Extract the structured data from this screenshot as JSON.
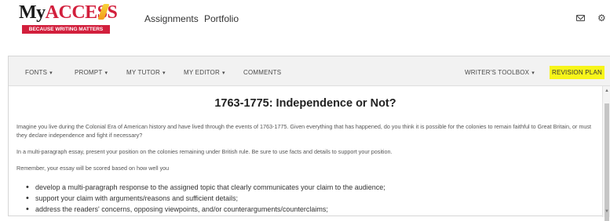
{
  "header": {
    "logo_text_prefix": "My",
    "logo_text_accent": "ACCESS",
    "logo_tagline": "BECAUSE WRITING MATTERS",
    "nav": [
      "Assignments",
      "Portfolio"
    ],
    "icons": [
      "mail-icon",
      "gear-icon"
    ]
  },
  "toolbar": {
    "fonts": "FONTS",
    "prompt": "PROMPT",
    "my_tutor": "MY TUTOR",
    "my_editor": "MY EDITOR",
    "comments": "COMMENTS",
    "writers_toolbox": "WRITER'S TOOLBOX",
    "revision_plan": "REVISION PLAN",
    "caret": "▾"
  },
  "prompt": {
    "title": "1763-1775: Independence or Not?",
    "paragraphs": [
      "Imagine you live during the Colonial Era of American history and have lived through the events of 1763-1775. Given everything that has happened, do you think it is possible for the colonies to remain faithful to Great Britain, or must they declare independence and fight if necessary?",
      "In a multi-paragraph essay, present your position on the colonies remaining under British rule. Be sure to use facts and details to support your position.",
      "Remember, your essay will be scored based on how well you"
    ],
    "bullets": [
      "develop a multi-paragraph response to the assigned topic that clearly communicates your claim to the audience;",
      "support your claim with arguments/reasons and sufficient details;",
      "address the readers' concerns, opposing viewpoints, and/or counterarguments/counterclaims;"
    ]
  },
  "colors": {
    "brand_red": "#d21f3c",
    "highlight_yellow": "#f7f51a",
    "toolbar_bg": "#f2f2f2"
  }
}
